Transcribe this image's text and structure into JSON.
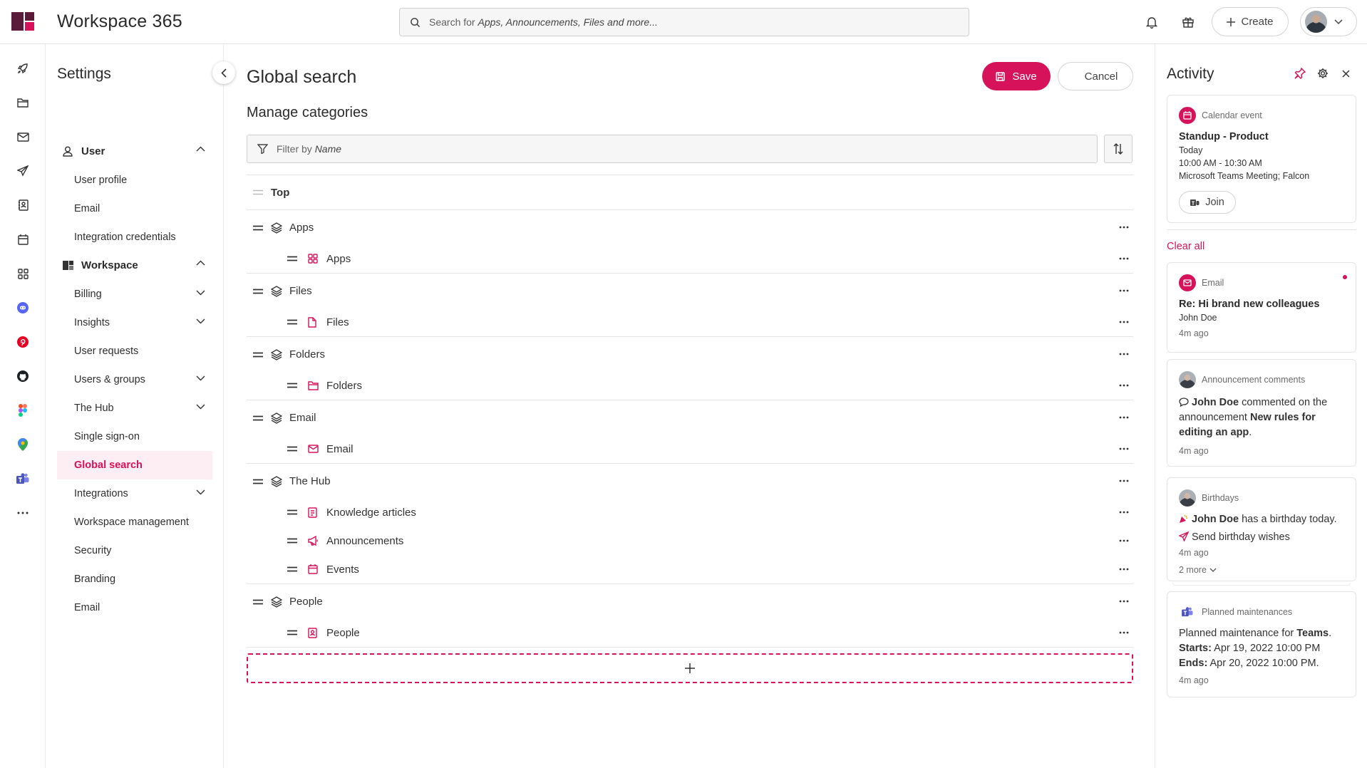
{
  "app": {
    "title": "Workspace 365"
  },
  "search": {
    "placeholder_prefix": "Search for ",
    "placeholder_emphasis": "Apps, Announcements, Files and more..."
  },
  "header": {
    "create_label": "Create"
  },
  "settings": {
    "title": "Settings",
    "groups": [
      {
        "label": "User",
        "items": [
          {
            "label": "User profile"
          },
          {
            "label": "Email"
          },
          {
            "label": "Integration credentials"
          }
        ]
      },
      {
        "label": "Workspace",
        "items": [
          {
            "label": "Billing",
            "expandable": true
          },
          {
            "label": "Insights",
            "expandable": true
          },
          {
            "label": "User requests"
          },
          {
            "label": "Users & groups",
            "expandable": true
          },
          {
            "label": "The Hub",
            "expandable": true
          },
          {
            "label": "Single sign-on"
          },
          {
            "label": "Global search",
            "active": true
          },
          {
            "label": "Integrations",
            "expandable": true
          },
          {
            "label": "Workspace management"
          },
          {
            "label": "Security"
          },
          {
            "label": "Branding"
          },
          {
            "label": "Email"
          }
        ]
      }
    ]
  },
  "main": {
    "title": "Global search",
    "save_label": "Save",
    "cancel_label": "Cancel",
    "section_title": "Manage categories",
    "filter_prefix": "Filter by ",
    "filter_emphasis": "Name",
    "top_label": "Top",
    "categories": [
      {
        "label": "Apps",
        "children": [
          {
            "label": "Apps",
            "icon": "grid-icon"
          }
        ]
      },
      {
        "label": "Files",
        "children": [
          {
            "label": "Files",
            "icon": "file-icon"
          }
        ]
      },
      {
        "label": "Folders",
        "children": [
          {
            "label": "Folders",
            "icon": "folder-icon"
          }
        ]
      },
      {
        "label": "Email",
        "children": [
          {
            "label": "Email",
            "icon": "mail-icon"
          }
        ]
      },
      {
        "label": "The Hub",
        "children": [
          {
            "label": "Knowledge articles",
            "icon": "book-icon"
          },
          {
            "label": "Announcements",
            "icon": "megaphone-icon"
          },
          {
            "label": "Events",
            "icon": "calendar-icon"
          }
        ]
      },
      {
        "label": "People",
        "children": [
          {
            "label": "People",
            "icon": "contact-icon"
          }
        ]
      }
    ]
  },
  "activity": {
    "title": "Activity",
    "clear_all": "Clear all",
    "calendar": {
      "type": "Calendar event",
      "title": "Standup - Product",
      "day": "Today",
      "time": "10:00 AM - 10:30 AM",
      "location": "Microsoft Teams Meeting; Falcon",
      "join_label": "Join"
    },
    "email": {
      "type": "Email",
      "subject": "Re: Hi brand new colleagues",
      "sender": "John Doe",
      "time": "4m ago"
    },
    "announcement": {
      "type": "Announcement comments",
      "actor": "John Doe",
      "text_mid": " commented on the announcement ",
      "target": "New rules for editing an app",
      "end": ".",
      "time": "4m ago"
    },
    "birthdays": {
      "type": "Birthdays",
      "person": "John Doe",
      "text": " has a birthday today.",
      "action": "Send birthday wishes",
      "time": "4m ago",
      "more": "2 more"
    },
    "maintenance": {
      "type": "Planned maintenances",
      "text": "Planned maintenance for ",
      "service": "Teams",
      "end": ".",
      "starts_label": "Starts:",
      "starts": " Apr 19, 2022 10:00 PM",
      "ends_label": "Ends:",
      "ends": " Apr 20, 2022 10:00 PM.",
      "time": "4m ago"
    }
  },
  "colors": {
    "accent": "#d6135a",
    "logo_dark": "#5a1a3a"
  }
}
